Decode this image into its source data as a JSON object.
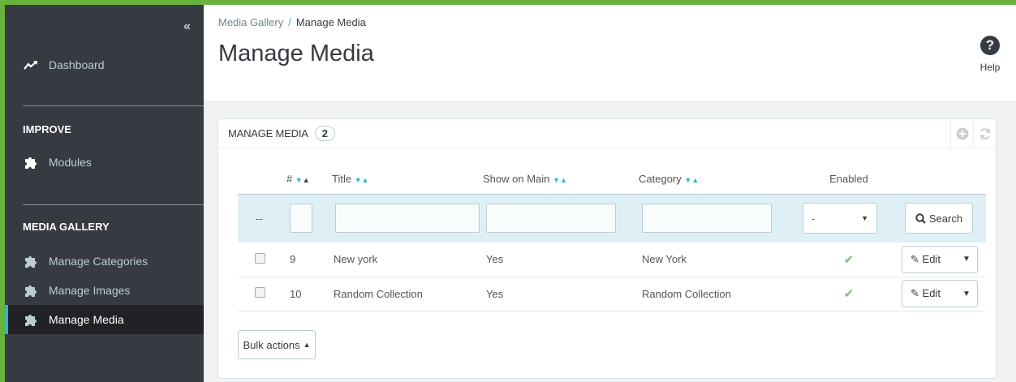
{
  "sidebar": {
    "collapse_icon": "«",
    "dashboard": "Dashboard",
    "improve_title": "IMPROVE",
    "modules": "Modules",
    "media_gallery_title": "MEDIA GALLERY",
    "items": [
      {
        "label": "Manage Categories"
      },
      {
        "label": "Manage Images"
      },
      {
        "label": "Manage Media"
      }
    ]
  },
  "header": {
    "breadcrumb_parent": "Media Gallery",
    "breadcrumb_sep": "/",
    "breadcrumb_current": "Manage Media",
    "title": "Manage Media",
    "help_label": "Help",
    "help_glyph": "?"
  },
  "panel": {
    "title": "MANAGE MEDIA",
    "count": "2",
    "columns": {
      "id": "#",
      "title": "Title",
      "show_on_main": "Show on Main",
      "category": "Category",
      "enabled": "Enabled"
    },
    "filter": {
      "dash": "--",
      "enabled_value": "-",
      "search_label": "Search"
    },
    "rows": [
      {
        "id": "9",
        "title": "New york",
        "show_on_main": "Yes",
        "category": "New York",
        "edit": "Edit"
      },
      {
        "id": "10",
        "title": "Random Collection",
        "show_on_main": "Yes",
        "category": "Random Collection",
        "edit": "Edit"
      }
    ],
    "bulk_label": "Bulk actions"
  },
  "colors": {
    "accent": "#25b9d7",
    "sidebar": "#363a41",
    "frame": "#6ab23e",
    "ok": "#72c279"
  }
}
